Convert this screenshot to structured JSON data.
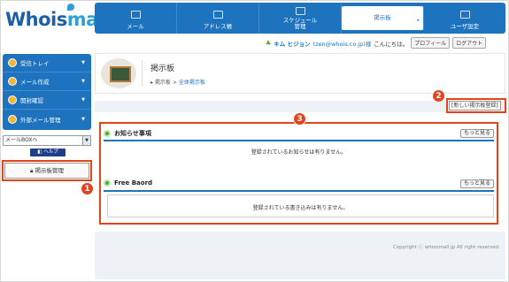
{
  "logo": {
    "text_main": "Whois",
    "text_accent": "mail"
  },
  "nav": {
    "items": [
      {
        "label": "メール",
        "icon": "mail-icon"
      },
      {
        "label": "アドレス帳",
        "icon": "address-book-icon"
      },
      {
        "label": "スケジュール\n管理",
        "icon": "schedule-icon"
      },
      {
        "label": "掲示板",
        "icon": "board-icon"
      },
      {
        "label": "ユーザ設定",
        "icon": "user-settings-icon"
      }
    ]
  },
  "userbar": {
    "name": "キム ヒジョン",
    "email": "(zen@whois.co.jp)様",
    "greeting": "こんにちは。",
    "profile_label": "プロフィール",
    "logout_label": "ログアウト"
  },
  "sidebar": {
    "items": [
      {
        "label": "受信トレイ"
      },
      {
        "label": "メール作成"
      },
      {
        "label": "開封確認"
      },
      {
        "label": "外部メール管理"
      }
    ],
    "mailbox_select": "メールBOXへ",
    "help_label": "ヘルプ",
    "board_admin_label": "掲示板管理"
  },
  "page": {
    "title": "掲示板",
    "breadcrumb_root": "掲示板",
    "breadcrumb_sep": ">",
    "breadcrumb_current": "全体掲示板",
    "new_board_label": "[新しい掲示板登録]"
  },
  "sections": {
    "notice": {
      "title": "お知らせ事項",
      "more_label": "もっと見る",
      "empty": "登録されているお知らせは有りません。"
    },
    "free": {
      "title": "Free Baord",
      "more_label": "もっと見る",
      "empty": "登録されている書き込みは有りません。"
    }
  },
  "callouts": {
    "one": "1",
    "two": "2",
    "three": "3"
  },
  "footer": {
    "copyright": "Copyright ⓒ whoismail.jp All right reserved."
  },
  "colors": {
    "brand": "#1e73be",
    "callout": "#e0451c",
    "accent_green": "#4caf2a"
  }
}
